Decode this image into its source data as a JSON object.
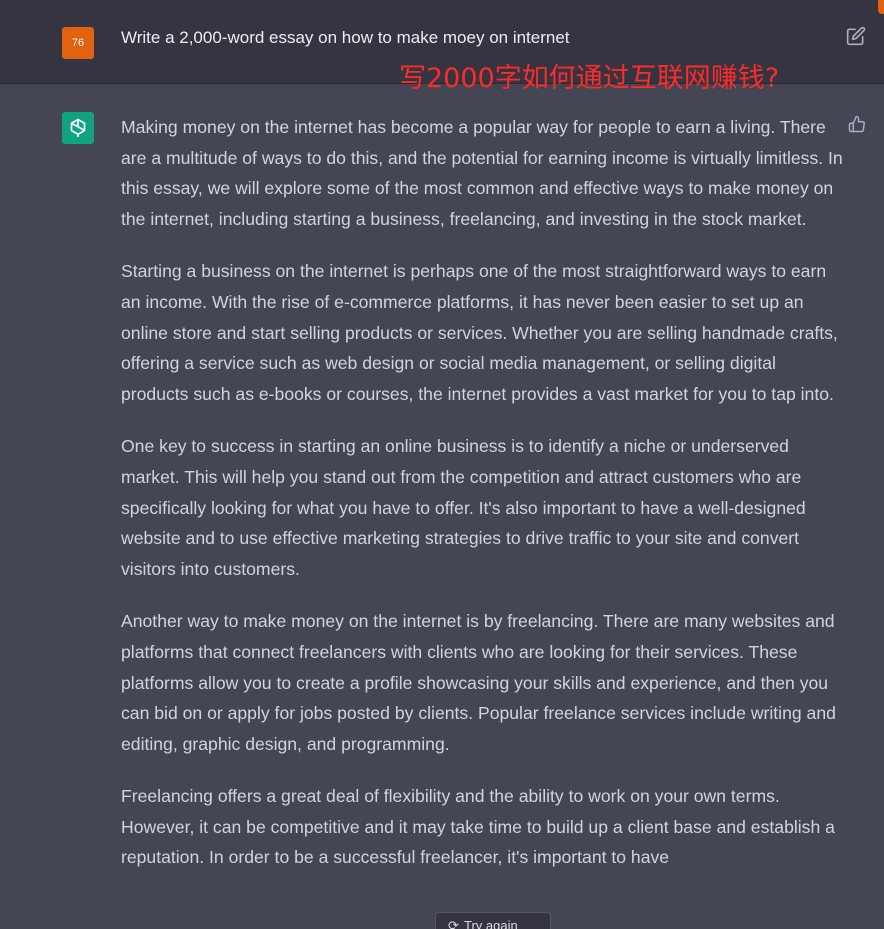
{
  "user_message": {
    "avatar_label": "76",
    "text": "Write a 2,000-word essay on how to make moey on internet",
    "annotation": "写2000字如何通过互联网赚钱?"
  },
  "assistant_message": {
    "paragraphs": [
      "Making money on the internet has become a popular way for people to earn a living. There are a multitude of ways to do this, and the potential for earning income is virtually limitless. In this essay, we will explore some of the most common and effective ways to make money on the internet, including starting a business, freelancing, and investing in the stock market.",
      "Starting a business on the internet is perhaps one of the most straightforward ways to earn an income. With the rise of e-commerce platforms, it has never been easier to set up an online store and start selling products or services. Whether you are selling handmade crafts, offering a service such as web design or social media management, or selling digital products such as e-books or courses, the internet provides a vast market for you to tap into.",
      "One key to success in starting an online business is to identify a niche or underserved market. This will help you stand out from the competition and attract customers who are specifically looking for what you have to offer. It's also important to have a well-designed website and to use effective marketing strategies to drive traffic to your site and convert visitors into customers.",
      "Another way to make money on the internet is by freelancing. There are many websites and platforms that connect freelancers with clients who are looking for their services. These platforms allow you to create a profile showcasing your skills and experience, and then you can bid on or apply for jobs posted by clients. Popular freelance services include writing and editing, graphic design, and programming.",
      "Freelancing offers a great deal of flexibility and the ability to work on your own terms. However, it can be competitive and it may take time to build up a client base and establish a reputation. In order to be a successful freelancer, it's important to have"
    ]
  },
  "bottom_button": {
    "label": "Try again"
  },
  "icons": {
    "edit": "edit-icon",
    "bot_avatar": "openai-logo-icon",
    "thumbs": "thumbs-up-icon",
    "refresh": "refresh-icon"
  },
  "colors": {
    "user_bg": "#343541",
    "assistant_bg": "#444654",
    "user_avatar": "#e1620f",
    "bot_avatar": "#10a37f",
    "annotation": "#ff2a2a"
  }
}
